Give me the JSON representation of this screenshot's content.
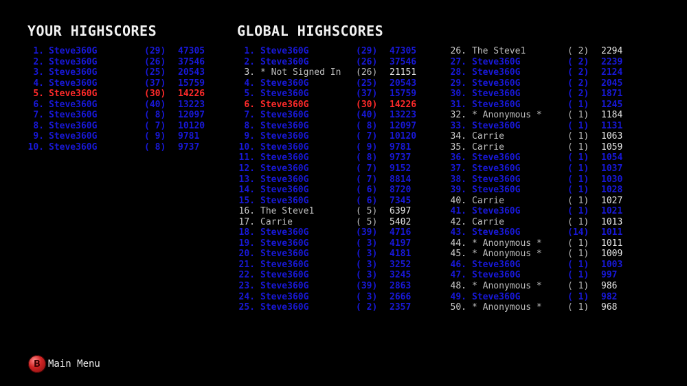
{
  "your_highscores": {
    "title": "YOUR HIGHSCORES",
    "rows": [
      {
        "rank": "1.",
        "name": "Steve360G",
        "plays": "(29)",
        "score": "47305",
        "style": "blue"
      },
      {
        "rank": "2.",
        "name": "Steve360G",
        "plays": "(26)",
        "score": "37546",
        "style": "blue"
      },
      {
        "rank": "3.",
        "name": "Steve360G",
        "plays": "(25)",
        "score": "20543",
        "style": "blue"
      },
      {
        "rank": "4.",
        "name": "Steve360G",
        "plays": "(37)",
        "score": "15759",
        "style": "blue"
      },
      {
        "rank": "5.",
        "name": "Steve360G",
        "plays": "(30)",
        "score": "14226",
        "style": "red"
      },
      {
        "rank": "6.",
        "name": "Steve360G",
        "plays": "(40)",
        "score": "13223",
        "style": "blue"
      },
      {
        "rank": "7.",
        "name": "Steve360G",
        "plays": "( 8)",
        "score": "12097",
        "style": "blue"
      },
      {
        "rank": "8.",
        "name": "Steve360G",
        "plays": "( 7)",
        "score": "10120",
        "style": "blue"
      },
      {
        "rank": "9.",
        "name": "Steve360G",
        "plays": "( 9)",
        "score": "9781",
        "style": "blue"
      },
      {
        "rank": "10.",
        "name": "Steve360G",
        "plays": "( 8)",
        "score": "9737",
        "style": "blue"
      }
    ]
  },
  "global_highscores": {
    "title": "GLOBAL HIGHSCORES",
    "column1": [
      {
        "rank": "1.",
        "name": "Steve360G",
        "plays": "(29)",
        "score": "47305",
        "style": "blue"
      },
      {
        "rank": "2.",
        "name": "Steve360G",
        "plays": "(26)",
        "score": "37546",
        "style": "blue"
      },
      {
        "rank": "3.",
        "name": "* Not Signed In",
        "plays": "(26)",
        "score": "21151",
        "style": "gray"
      },
      {
        "rank": "4.",
        "name": "Steve360G",
        "plays": "(25)",
        "score": "20543",
        "style": "blue"
      },
      {
        "rank": "5.",
        "name": "Steve360G",
        "plays": "(37)",
        "score": "15759",
        "style": "blue"
      },
      {
        "rank": "6.",
        "name": "Steve360G",
        "plays": "(30)",
        "score": "14226",
        "style": "red"
      },
      {
        "rank": "7.",
        "name": "Steve360G",
        "plays": "(40)",
        "score": "13223",
        "style": "blue"
      },
      {
        "rank": "8.",
        "name": "Steve360G",
        "plays": "( 8)",
        "score": "12097",
        "style": "blue"
      },
      {
        "rank": "9.",
        "name": "Steve360G",
        "plays": "( 7)",
        "score": "10120",
        "style": "blue"
      },
      {
        "rank": "10.",
        "name": "Steve360G",
        "plays": "( 9)",
        "score": "9781",
        "style": "blue"
      },
      {
        "rank": "11.",
        "name": "Steve360G",
        "plays": "( 8)",
        "score": "9737",
        "style": "blue"
      },
      {
        "rank": "12.",
        "name": "Steve360G",
        "plays": "( 7)",
        "score": "9152",
        "style": "blue"
      },
      {
        "rank": "13.",
        "name": "Steve360G",
        "plays": "( 7)",
        "score": "8814",
        "style": "blue"
      },
      {
        "rank": "14.",
        "name": "Steve360G",
        "plays": "( 6)",
        "score": "8720",
        "style": "blue"
      },
      {
        "rank": "15.",
        "name": "Steve360G",
        "plays": "( 6)",
        "score": "7345",
        "style": "blue"
      },
      {
        "rank": "16.",
        "name": "The Steve1",
        "plays": "( 5)",
        "score": "6397",
        "style": "gray"
      },
      {
        "rank": "17.",
        "name": "Carrie",
        "plays": "( 5)",
        "score": "5402",
        "style": "gray"
      },
      {
        "rank": "18.",
        "name": "Steve360G",
        "plays": "(39)",
        "score": "4716",
        "style": "blue"
      },
      {
        "rank": "19.",
        "name": "Steve360G",
        "plays": "( 3)",
        "score": "4197",
        "style": "blue"
      },
      {
        "rank": "20.",
        "name": "Steve360G",
        "plays": "( 3)",
        "score": "4181",
        "style": "blue"
      },
      {
        "rank": "21.",
        "name": "Steve360G",
        "plays": "( 3)",
        "score": "3252",
        "style": "blue"
      },
      {
        "rank": "22.",
        "name": "Steve360G",
        "plays": "( 3)",
        "score": "3245",
        "style": "blue"
      },
      {
        "rank": "23.",
        "name": "Steve360G",
        "plays": "(39)",
        "score": "2863",
        "style": "blue"
      },
      {
        "rank": "24.",
        "name": "Steve360G",
        "plays": "( 3)",
        "score": "2666",
        "style": "blue"
      },
      {
        "rank": "25.",
        "name": "Steve360G",
        "plays": "( 2)",
        "score": "2357",
        "style": "blue"
      }
    ],
    "column2": [
      {
        "rank": "26.",
        "name": "The Steve1",
        "plays": "( 2)",
        "score": "2294",
        "style": "gray"
      },
      {
        "rank": "27.",
        "name": "Steve360G",
        "plays": "( 2)",
        "score": "2239",
        "style": "blue"
      },
      {
        "rank": "28.",
        "name": "Steve360G",
        "plays": "( 2)",
        "score": "2124",
        "style": "blue"
      },
      {
        "rank": "29.",
        "name": "Steve360G",
        "plays": "( 2)",
        "score": "2045",
        "style": "blue"
      },
      {
        "rank": "30.",
        "name": "Steve360G",
        "plays": "( 2)",
        "score": "1871",
        "style": "blue"
      },
      {
        "rank": "31.",
        "name": "Steve360G",
        "plays": "( 1)",
        "score": "1245",
        "style": "blue"
      },
      {
        "rank": "32.",
        "name": "* Anonymous *",
        "plays": "( 1)",
        "score": "1184",
        "style": "gray"
      },
      {
        "rank": "33.",
        "name": "Steve360G",
        "plays": "( 1)",
        "score": "1131",
        "style": "blue"
      },
      {
        "rank": "34.",
        "name": "Carrie",
        "plays": "( 1)",
        "score": "1063",
        "style": "gray"
      },
      {
        "rank": "35.",
        "name": "Carrie",
        "plays": "( 1)",
        "score": "1059",
        "style": "gray"
      },
      {
        "rank": "36.",
        "name": "Steve360G",
        "plays": "( 1)",
        "score": "1054",
        "style": "blue"
      },
      {
        "rank": "37.",
        "name": "Steve360G",
        "plays": "( 1)",
        "score": "1037",
        "style": "blue"
      },
      {
        "rank": "38.",
        "name": "Steve360G",
        "plays": "( 1)",
        "score": "1030",
        "style": "blue"
      },
      {
        "rank": "39.",
        "name": "Steve360G",
        "plays": "( 1)",
        "score": "1028",
        "style": "blue"
      },
      {
        "rank": "40.",
        "name": "Carrie",
        "plays": "( 1)",
        "score": "1027",
        "style": "gray"
      },
      {
        "rank": "41.",
        "name": "Steve360G",
        "plays": "( 1)",
        "score": "1021",
        "style": "blue"
      },
      {
        "rank": "42.",
        "name": "Carrie",
        "plays": "( 1)",
        "score": "1013",
        "style": "gray"
      },
      {
        "rank": "43.",
        "name": "Steve360G",
        "plays": "(14)",
        "score": "1011",
        "style": "blue"
      },
      {
        "rank": "44.",
        "name": "* Anonymous *",
        "plays": "( 1)",
        "score": "1011",
        "style": "gray"
      },
      {
        "rank": "45.",
        "name": "* Anonymous *",
        "plays": "( 1)",
        "score": "1009",
        "style": "gray"
      },
      {
        "rank": "46.",
        "name": "Steve360G",
        "plays": "( 1)",
        "score": "1003",
        "style": "blue"
      },
      {
        "rank": "47.",
        "name": "Steve360G",
        "plays": "( 1)",
        "score": "997",
        "style": "blue"
      },
      {
        "rank": "48.",
        "name": "* Anonymous *",
        "plays": "( 1)",
        "score": "986",
        "style": "gray"
      },
      {
        "rank": "49.",
        "name": "Steve360G",
        "plays": "( 1)",
        "score": "982",
        "style": "blue"
      },
      {
        "rank": "50.",
        "name": "* Anonymous *",
        "plays": "( 1)",
        "score": "968",
        "style": "gray"
      }
    ]
  },
  "footer": {
    "button_glyph": "B",
    "button_icon": "b-button-icon",
    "label": "Main Menu"
  },
  "colors": {
    "current_player": "#1818d8",
    "latest_score": "#ff2a2a",
    "other_player": "#bdbdbd",
    "background": "#000000"
  }
}
